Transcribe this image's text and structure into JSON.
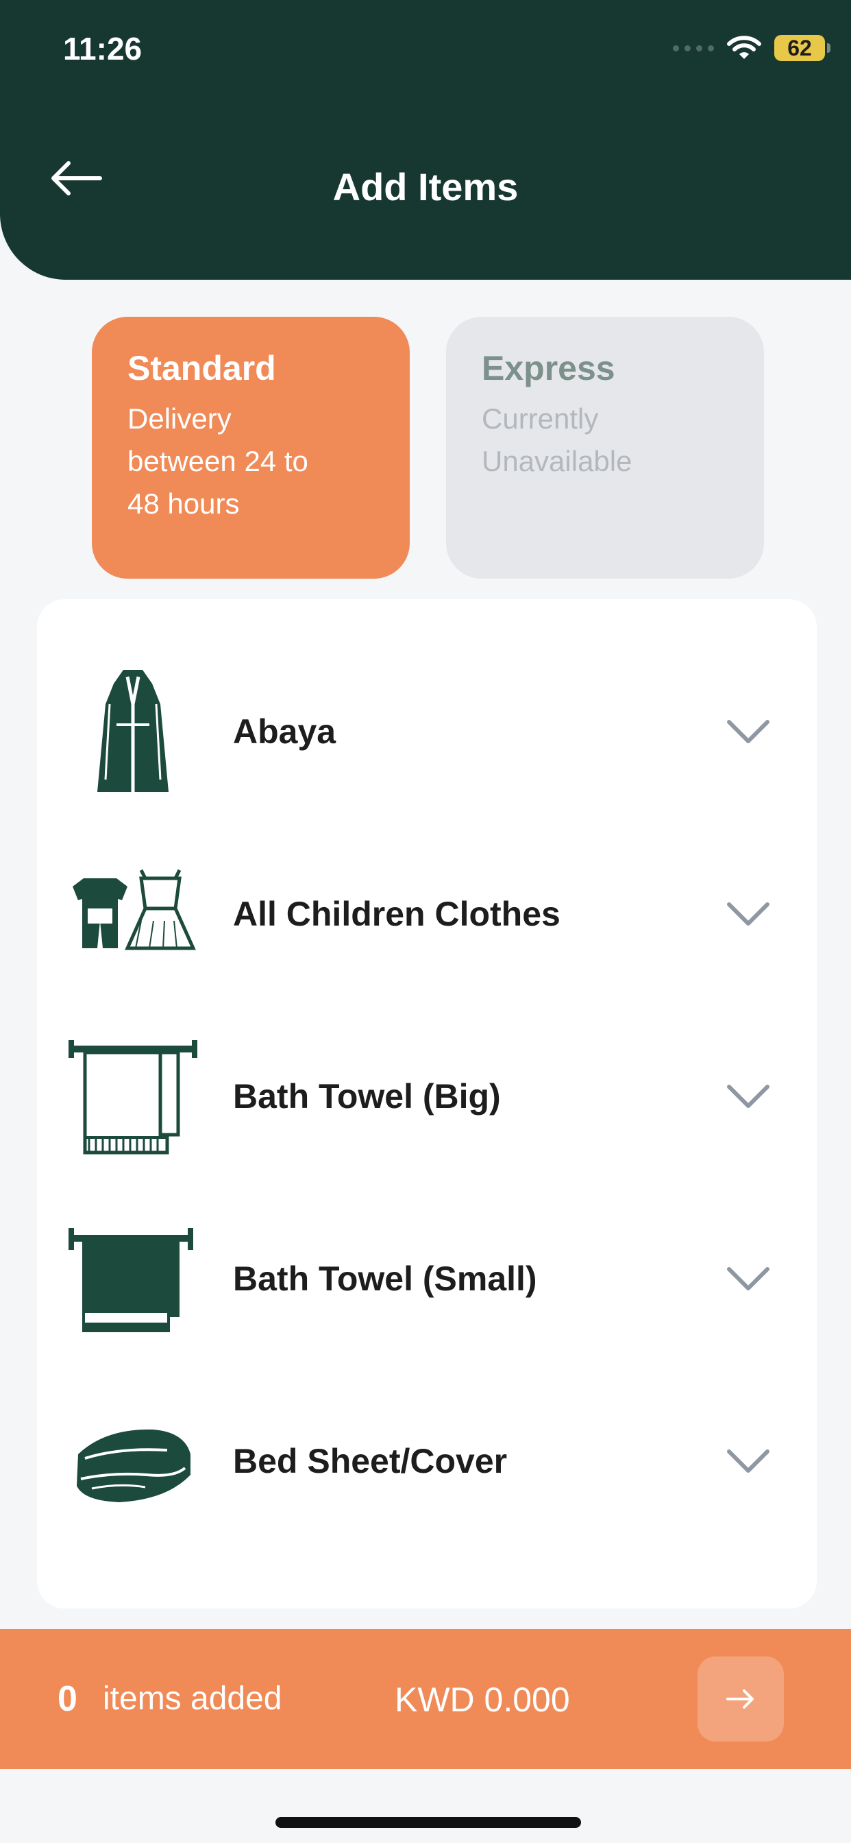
{
  "status_bar": {
    "time": "11:26",
    "battery": "62"
  },
  "header": {
    "title": "Add Items"
  },
  "delivery": {
    "standard": {
      "title": "Standard",
      "subtitle": "Delivery\nbetween 24 to\n48 hours"
    },
    "express": {
      "title": "Express",
      "subtitle": "Currently\nUnavailable"
    }
  },
  "items": [
    {
      "label": "Abaya",
      "icon": "abaya-icon"
    },
    {
      "label": "All Children Clothes",
      "icon": "children-clothes-icon"
    },
    {
      "label": "Bath Towel (Big)",
      "icon": "bath-towel-big-icon"
    },
    {
      "label": "Bath Towel (Small)",
      "icon": "bath-towel-small-icon"
    },
    {
      "label": "Bed Sheet/Cover",
      "icon": "bed-sheet-icon"
    }
  ],
  "cart": {
    "count": "0",
    "count_label": "items added",
    "total": "KWD 0.000"
  },
  "colors": {
    "header": "#163830",
    "accent": "#f08b58",
    "icon": "#1c4a3d"
  }
}
